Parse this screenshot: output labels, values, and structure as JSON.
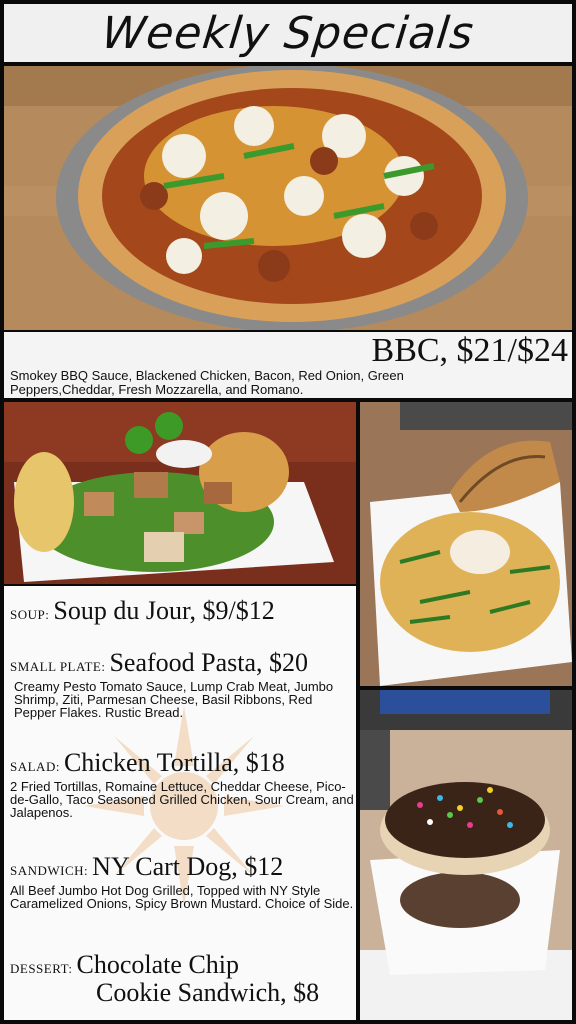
{
  "header": {
    "title": "Weekly Specials"
  },
  "feature": {
    "title": "BBC, $21/$24",
    "description": "Smokey BBQ Sauce, Blackened Chicken, Bacon, Red Onion, Green Peppers,Cheddar, Fresh Mozzarella, and Romano."
  },
  "menu": {
    "soup": {
      "category": "SOUP:",
      "name": "Soup du Jour, $9/$12"
    },
    "small_plate": {
      "category": "SMALL PLATE:",
      "name": "Seafood Pasta, $20",
      "description": "Creamy Pesto Tomato Sauce, Lump Crab Meat, Jumbo Shrimp, Ziti, Parmesan Cheese, Basil Ribbons, Red Pepper Flakes. Rustic Bread."
    },
    "salad": {
      "category": "SALAD:",
      "name": "Chicken Tortilla, $18",
      "description": "2 Fried Tortillas, Romaine Lettuce, Cheddar Cheese, Pico-de-Gallo, Taco Seasoned Grilled Chicken, Sour Cream, and Jalapenos."
    },
    "sandwich": {
      "category": "SANDWICH:",
      "name": "NY Cart Dog, $12",
      "description": "All Beef Jumbo Hot Dog Grilled, Topped with NY Style Caramelized Onions, Spicy Brown Mustard. Choice of Side."
    },
    "dessert": {
      "category": "DESSERT:",
      "name_line1": "Chocolate Chip",
      "name_line2": "Cookie Sandwich, $8"
    }
  }
}
